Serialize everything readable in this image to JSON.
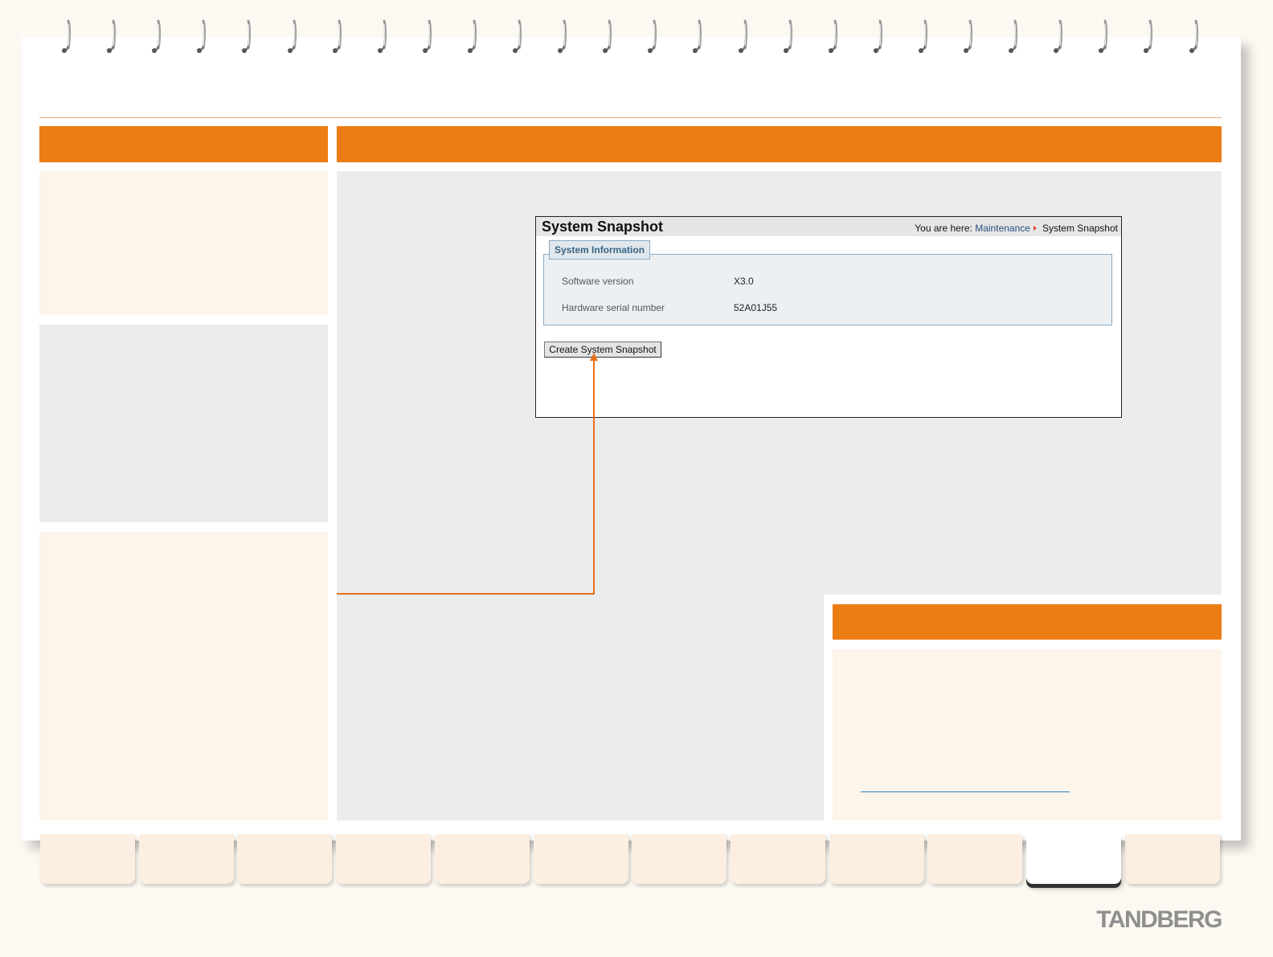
{
  "system_snapshot_window": {
    "title": "System Snapshot",
    "breadcrumb": {
      "prefix": "You are here:",
      "parent_link": "Maintenance",
      "current": "System Snapshot"
    },
    "system_information": {
      "legend": "System Information",
      "rows": [
        {
          "label": "Software version",
          "value": "X3.0"
        },
        {
          "label": "Hardware serial number",
          "value": "52A01J55"
        }
      ]
    },
    "create_button": "Create System Snapshot"
  },
  "brand": {
    "logo": "TANDBERG"
  },
  "colors": {
    "accent_orange": "#ec7d14",
    "panel_peach": "#fdf4ea",
    "panel_grey": "#ebecee",
    "link_blue": "#2a4f7f"
  },
  "icons": {
    "binder_ring": "spiral-ring-icon",
    "breadcrumb_separator": "breadcrumb-arrow-icon",
    "callout_arrow": "callout-arrow-icon"
  }
}
